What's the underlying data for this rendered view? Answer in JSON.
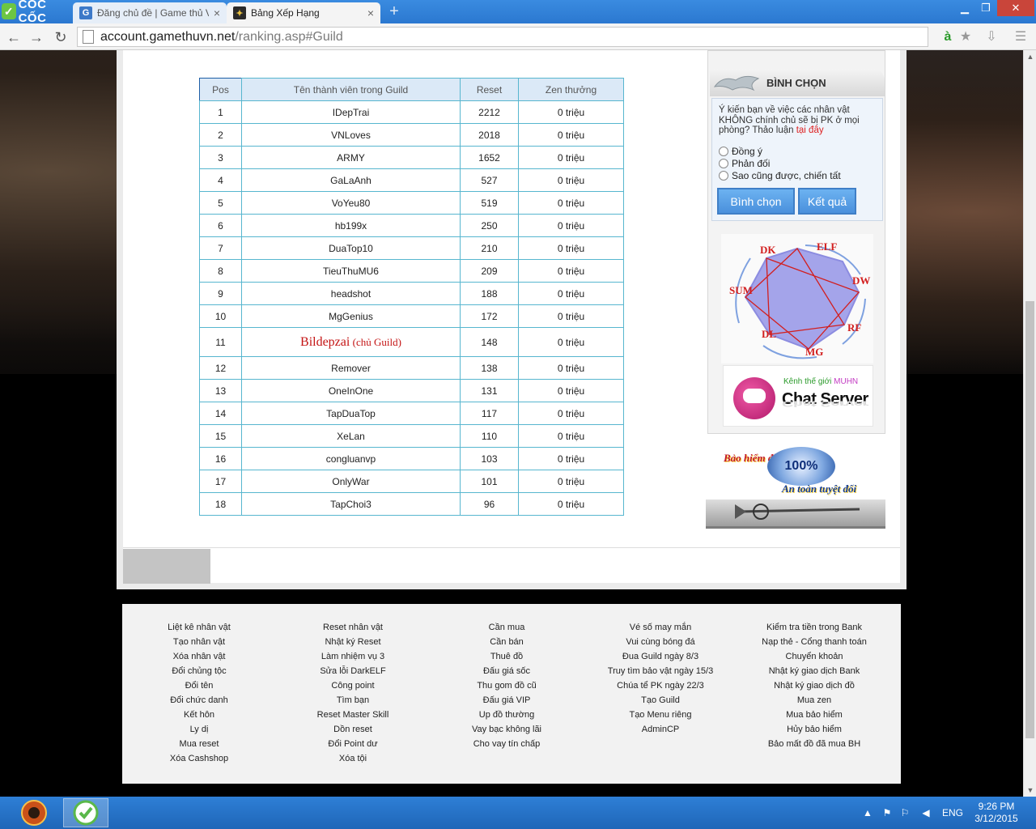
{
  "browser": {
    "logo_text": "CỐC CỐC",
    "tabs": [
      {
        "title": "Đăng chủ đề | Game thủ Vi",
        "favicon": "G"
      },
      {
        "title": "Bảng Xếp Hạng",
        "favicon": ""
      }
    ],
    "new_tab": "+",
    "url_host": "account.gamethuvn.net",
    "url_path": "/ranking.asp#Guild"
  },
  "ranking": {
    "headers": {
      "pos": "Pos",
      "name": "Tên thành viên trong Guild",
      "reset": "Reset",
      "zen": "Zen thưởng"
    },
    "rows": [
      {
        "pos": "1",
        "name": "IDepTrai",
        "reset": "2212",
        "zen": "0 triệu"
      },
      {
        "pos": "2",
        "name": "VNLoves",
        "reset": "2018",
        "zen": "0 triệu"
      },
      {
        "pos": "3",
        "name": "ARMY",
        "reset": "1652",
        "zen": "0 triệu"
      },
      {
        "pos": "4",
        "name": "GaLaAnh",
        "reset": "527",
        "zen": "0 triệu"
      },
      {
        "pos": "5",
        "name": "VoYeu80",
        "reset": "519",
        "zen": "0 triệu"
      },
      {
        "pos": "6",
        "name": "hb199x",
        "reset": "250",
        "zen": "0 triệu"
      },
      {
        "pos": "7",
        "name": "DuaTop10",
        "reset": "210",
        "zen": "0 triệu"
      },
      {
        "pos": "8",
        "name": "TieuThuMU6",
        "reset": "209",
        "zen": "0 triệu"
      },
      {
        "pos": "9",
        "name": "headshot",
        "reset": "188",
        "zen": "0 triệu"
      },
      {
        "pos": "10",
        "name": "MgGenius",
        "reset": "172",
        "zen": "0 triệu"
      },
      {
        "pos": "11",
        "name": "Bildepzai",
        "note": "(chủ Guild)",
        "reset": "148",
        "zen": "0 triệu",
        "leader": true
      },
      {
        "pos": "12",
        "name": "Remover",
        "reset": "138",
        "zen": "0 triệu"
      },
      {
        "pos": "13",
        "name": "OneInOne",
        "reset": "131",
        "zen": "0 triệu"
      },
      {
        "pos": "14",
        "name": "TapDuaTop",
        "reset": "117",
        "zen": "0 triệu"
      },
      {
        "pos": "15",
        "name": "XeLan",
        "reset": "110",
        "zen": "0 triệu"
      },
      {
        "pos": "16",
        "name": "congluanvp",
        "reset": "103",
        "zen": "0 triệu"
      },
      {
        "pos": "17",
        "name": "OnlyWar",
        "reset": "101",
        "zen": "0 triệu"
      },
      {
        "pos": "18",
        "name": "TapChoi3",
        "reset": "96",
        "zen": "0 triệu"
      }
    ]
  },
  "vote": {
    "title": "BÌNH CHỌN",
    "question": "Ý kiến bạn về việc các nhân vật KHÔNG chính chủ sẽ bị PK ở mọi phòng? Thảo luận",
    "question_link": "tại đây",
    "options": [
      "Đồng ý",
      "Phản đối",
      "Sao cũng được, chiến tất"
    ],
    "vote_button": "Bình chọn",
    "result_button": "Kết quả"
  },
  "class_wheel": {
    "labels": [
      "DK",
      "ELF",
      "DW",
      "RF",
      "MG",
      "DL",
      "SUM"
    ],
    "colors": {
      "fill": "#9a9ae6",
      "line": "#d21e1e",
      "label": "#d21e1e"
    }
  },
  "chat_banner": {
    "sub_prefix": "Kênh thế giới",
    "sub_highlight": "MUHN",
    "title": "Chat Server"
  },
  "insurance": {
    "line1": "Bảo hiểm đồ",
    "seal": "100%",
    "line2": "An toàn tuyệt đối"
  },
  "footer": {
    "columns": [
      [
        "Liệt kê nhân vật",
        "Tạo nhân vật",
        "Xóa nhân vật",
        "Đổi chủng tộc",
        "Đổi tên",
        "Đổi chức danh",
        "Kết hôn",
        "Ly dị",
        "Mua reset",
        "Xóa Cashshop"
      ],
      [
        "Reset nhân vật",
        "Nhật ký Reset",
        "Làm nhiệm vụ 3",
        "Sửa lỗi DarkELF",
        "Công point",
        "Tìm bạn",
        "Reset Master Skill",
        "Dồn reset",
        "Đổi Point dư",
        "Xóa tội"
      ],
      [
        "Cần mua",
        "Cần bán",
        "Thuê đồ",
        "Đấu giá sốc",
        "Thu gom đồ cũ",
        "Đấu giá VIP",
        "Up đồ thường",
        "Vay bạc không lãi",
        "Cho vay tín chấp"
      ],
      [
        "Vé số may mắn",
        "Vui cùng bóng đá",
        "Đua Guild ngày 8/3",
        "Truy tìm bảo vật ngày 15/3",
        "Chúa tể PK ngày 22/3",
        "Tạo Guild",
        "Tạo Menu riêng",
        "AdminCP"
      ],
      [
        "Kiểm tra tiền trong Bank",
        "Nạp thẻ - Cổng thanh toán",
        "Chuyển khoản",
        "Nhật ký giao dịch Bank",
        "Nhật ký giao dịch đồ",
        "Mua zen",
        "Mua bảo hiểm",
        "Hủy bảo hiểm",
        "Bảo mất đồ đã mua BH"
      ]
    ]
  },
  "taskbar": {
    "lang": "ENG",
    "time": "9:26 PM",
    "date": "3/12/2015"
  },
  "colors": {
    "tabbar": "#2b78d0",
    "table_border": "#57b6cf",
    "table_header": "#dbe9f7",
    "leader": "#c41414",
    "button": "#4a90dc"
  }
}
